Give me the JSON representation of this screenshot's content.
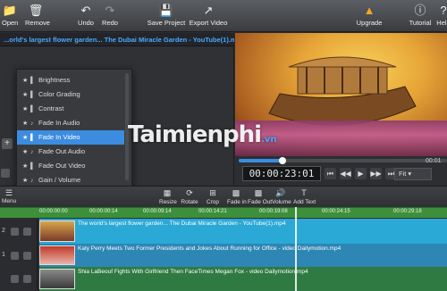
{
  "toolbar": {
    "open": "Open",
    "remove": "Remove",
    "undo": "Undo",
    "redo": "Redo",
    "save_project": "Save Project",
    "export_video": "Export Video",
    "upgrade": "Upgrade",
    "tutorial": "Tutorial",
    "help": "Help"
  },
  "file_bar": "...orld's largest flower garden... The Dubai Miracle Garden - YouTube(1).mp4",
  "menu": {
    "items": [
      {
        "label": "Brightness",
        "kind": "filter-icon"
      },
      {
        "label": "Color Grading",
        "kind": "filter-icon"
      },
      {
        "label": "Contrast",
        "kind": "filter-icon"
      },
      {
        "label": "Fade In Audio",
        "kind": "note-icon"
      },
      {
        "label": "Fade In Video",
        "kind": "filter-icon",
        "selected": true
      },
      {
        "label": "Fade Out Audio",
        "kind": "note-icon"
      },
      {
        "label": "Fade Out Video",
        "kind": "filter-icon"
      },
      {
        "label": "Gain / Volume",
        "kind": "note-icon"
      }
    ]
  },
  "watermark": {
    "brand": "Taimienphi",
    "suffix": ".vn"
  },
  "player": {
    "timecode": "00:00:23:01",
    "progress": 0.21,
    "fit": "Fit",
    "right_time": "00:01"
  },
  "timeline_toolbar": {
    "menu": "Menu",
    "resize": "Resize",
    "rotate": "Rotate",
    "crop": "Crop",
    "fade_in": "Fade in",
    "fade_out": "Fade Out",
    "volume": "Volume",
    "add_text": "Add Text"
  },
  "ruler": {
    "ticks": [
      "00:00:00:00",
      "00:00:00:14",
      "00:00:09:14",
      "00:00:14:21",
      "00:00:19:08",
      "00:00:24:15",
      "00:00:29:18"
    ]
  },
  "tracks": [
    {
      "num": "2",
      "title": "The world's largest flower garden... The Dubai Miracle Garden - YouTube(1).mp4",
      "color": "#2aa9d6"
    },
    {
      "num": "1",
      "title": "Katy Perry Meets Two Former Presidents and Jokes About Running for Office - video Dailymotion.mp4",
      "color": "#2d86b3"
    },
    {
      "num": "",
      "title": "Shia LaBeouf Fights With Girlfriend Then FaceTimes Megan Fox - video Dailymotion.mp4",
      "color": "#2f7a43"
    }
  ]
}
